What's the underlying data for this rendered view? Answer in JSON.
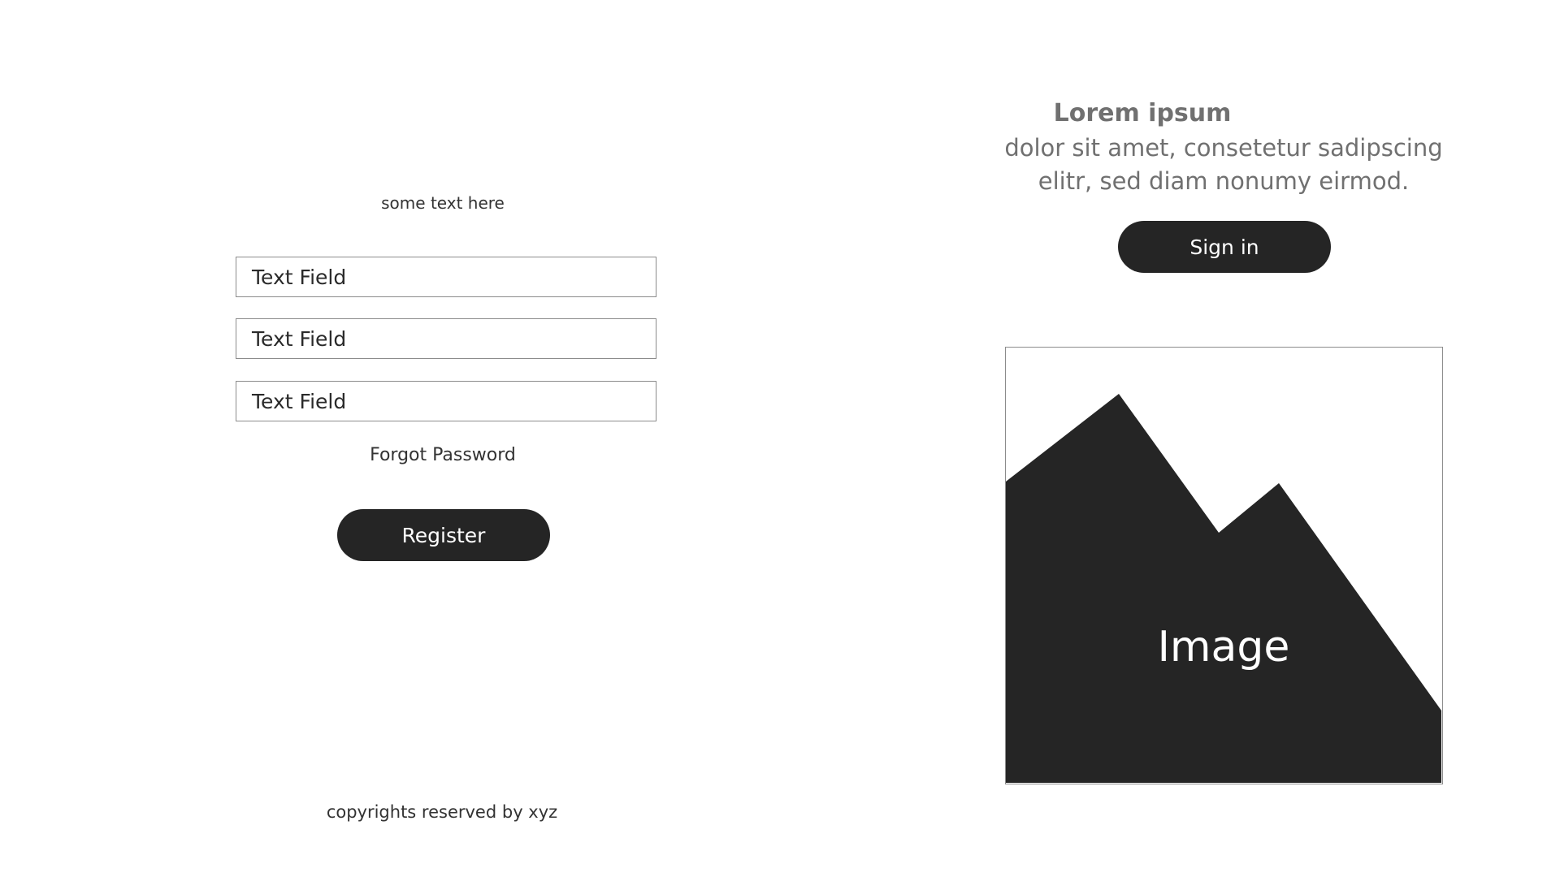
{
  "left_panel": {
    "tagline": "some text here",
    "fields": [
      {
        "value": "Text Field"
      },
      {
        "value": "Text Field"
      },
      {
        "value": "Text Field"
      }
    ],
    "forgot_password": "Forgot Password",
    "register_label": "Register",
    "copyright": "copyrights reserved by xyz"
  },
  "right_panel": {
    "title": "Lorem ipsum",
    "body": "dolor sit amet, consetetur sadipscing elitr, sed diam nonumy eirmod.",
    "signin_label": "Sign in",
    "image_label": "Image"
  },
  "colors": {
    "button_bg": "#252525",
    "muted_text": "#707070",
    "border": "#8c8c8c"
  }
}
